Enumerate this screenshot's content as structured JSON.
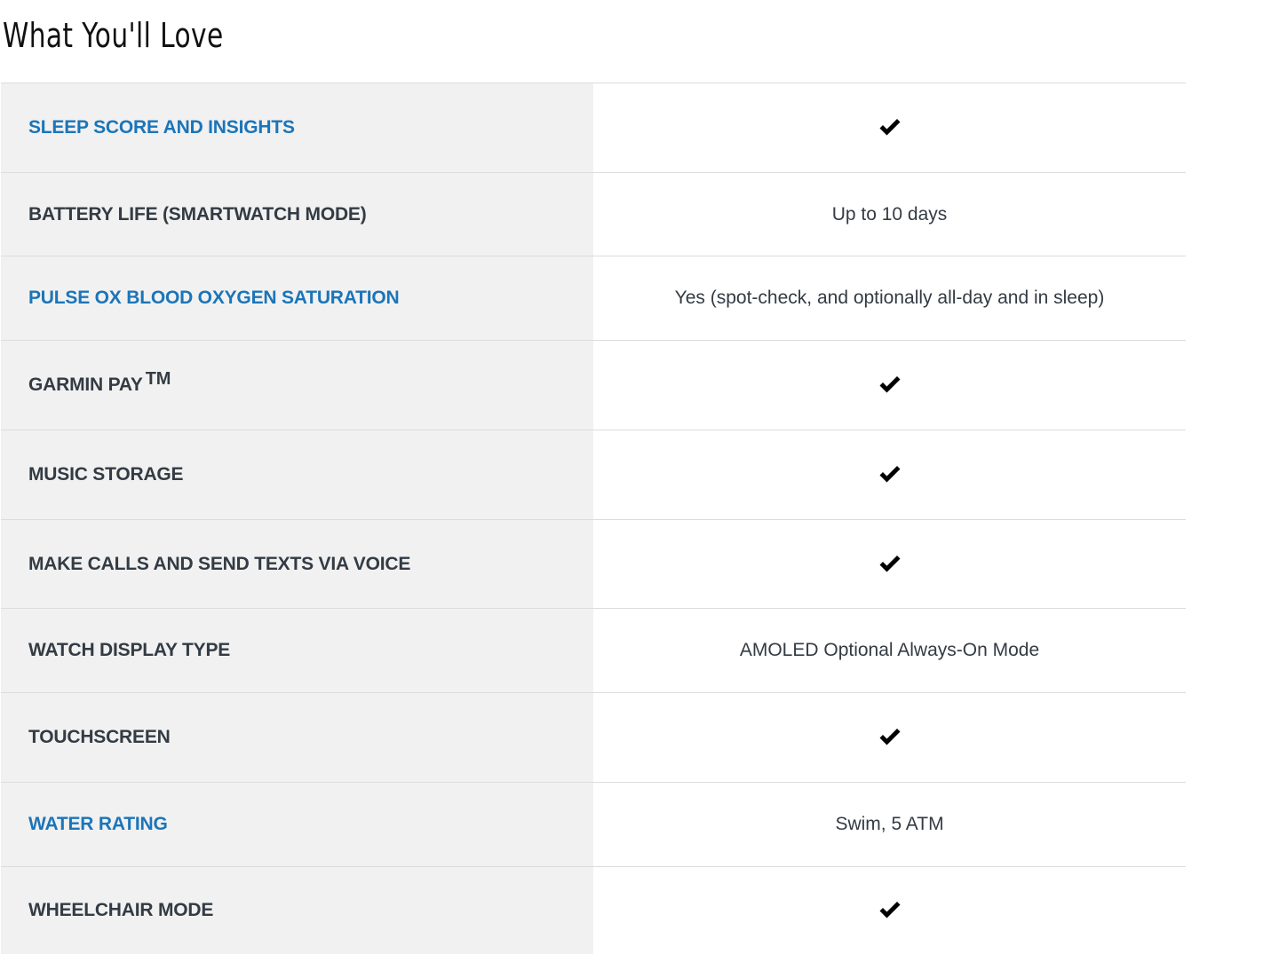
{
  "page": {
    "title": "What You'll Love"
  },
  "features": [
    {
      "label": "SLEEP SCORE AND INSIGHTS",
      "link": true,
      "value_type": "check",
      "value": ""
    },
    {
      "label": "BATTERY LIFE (SMARTWATCH MODE)",
      "link": false,
      "value_type": "text",
      "value": "Up to 10 days"
    },
    {
      "label": "PULSE OX BLOOD OXYGEN SATURATION",
      "link": true,
      "value_type": "text",
      "value": "Yes (spot-check, and optionally all-day and in sleep)"
    },
    {
      "label": "GARMIN PAY",
      "label_sup": "TM",
      "link": false,
      "value_type": "check",
      "value": ""
    },
    {
      "label": "MUSIC STORAGE",
      "link": false,
      "value_type": "check",
      "value": ""
    },
    {
      "label": "MAKE CALLS AND SEND TEXTS VIA VOICE",
      "link": false,
      "value_type": "check",
      "value": ""
    },
    {
      "label": "WATCH DISPLAY TYPE",
      "link": false,
      "value_type": "text",
      "value": "AMOLED Optional Always-On Mode"
    },
    {
      "label": "TOUCHSCREEN",
      "link": false,
      "value_type": "check",
      "value": ""
    },
    {
      "label": "WATER RATING",
      "link": true,
      "value_type": "text",
      "value": "Swim, 5 ATM"
    },
    {
      "label": "WHEELCHAIR MODE",
      "link": false,
      "value_type": "check",
      "value": ""
    }
  ],
  "icons": {
    "check": "checkmark-icon"
  },
  "colors": {
    "link": "#1b75b8",
    "label": "#333b44",
    "label_bg": "#f1f1f1",
    "divider": "#dcdcdc"
  }
}
